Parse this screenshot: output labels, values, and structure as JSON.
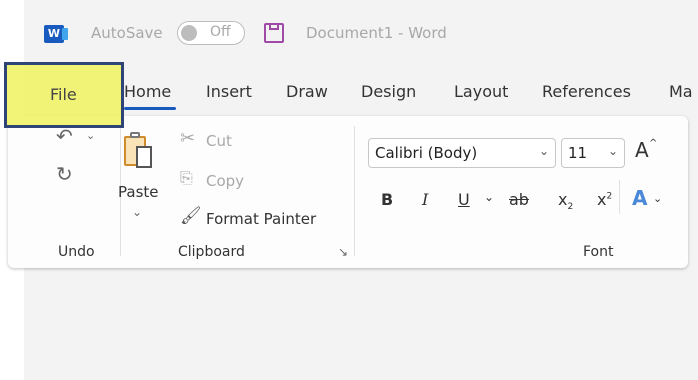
{
  "titlebar": {
    "app_icon_letter": "W",
    "autosave_label": "AutoSave",
    "autosave_state": "Off",
    "document_title": "Document1  -  Word"
  },
  "tabs": [
    {
      "label": "File"
    },
    {
      "label": "Home"
    },
    {
      "label": "Insert"
    },
    {
      "label": "Draw"
    },
    {
      "label": "Design"
    },
    {
      "label": "Layout"
    },
    {
      "label": "References"
    },
    {
      "label": "Ma"
    }
  ],
  "ribbon": {
    "undo_group": {
      "label": "Undo"
    },
    "clipboard_group": {
      "label": "Clipboard",
      "paste": "Paste",
      "cut": "Cut",
      "copy": "Copy",
      "format_painter": "Format Painter"
    },
    "font_group": {
      "label": "Font",
      "font_name": "Calibri (Body)",
      "font_size": "11",
      "bold": "B",
      "italic": "I",
      "underline": "U",
      "strikethrough": "ab",
      "subscript": "x",
      "subscript_mark": "2",
      "superscript": "x",
      "superscript_mark": "2",
      "grow_font": "A",
      "text_effects": "A"
    }
  },
  "colors": {
    "word_blue": "#185abd",
    "highlight": "#eef25f",
    "highlight_border": "#2f4477",
    "save_icon": "#a04aa7"
  }
}
